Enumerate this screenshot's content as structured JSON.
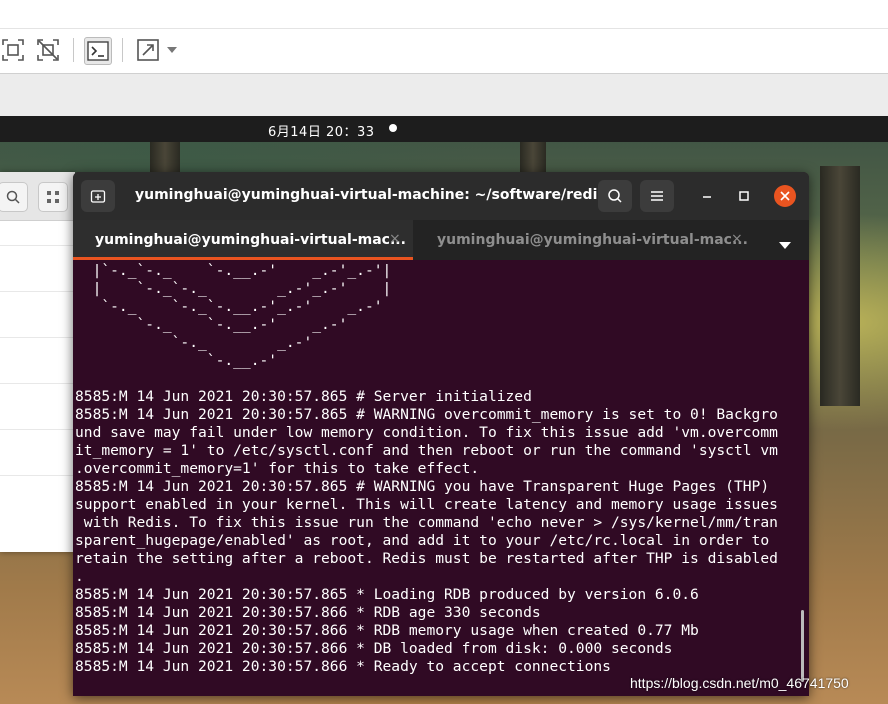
{
  "vm_toolbar": {
    "icons": [
      "fit-window-icon",
      "unscale-icon",
      "console-icon",
      "fullscreen-icon",
      "dropdown-arrow-icon"
    ]
  },
  "topbar": {
    "clock": "6月14日  20：33"
  },
  "terminal": {
    "title": "yuminghuai@yuminghuai-virtual-machine: ~/software/redis/...",
    "tabs": [
      {
        "label": "yuminghuai@yuminghuai-virtual-mac...",
        "active": true,
        "close": "×"
      },
      {
        "label": "yuminghuai@yuminghuai-virtual-mac...",
        "active": false,
        "close": "×"
      }
    ],
    "lines": [
      "  |`-._`-._    `-.__.-'    _.-'_.-'|",
      "  |    `-._`-._        _.-'_.-'    |",
      "   `-._    `-._`-.__.-'_.-'    _.-'",
      "       `-._    `-.__.-'    _.-'",
      "           `-._        _.-'",
      "               `-.__.-'",
      "",
      "8585:M 14 Jun 2021 20:30:57.865 # Server initialized",
      "8585:M 14 Jun 2021 20:30:57.865 # WARNING overcommit_memory is set to 0! Backgro",
      "und save may fail under low memory condition. To fix this issue add 'vm.overcomm",
      "it_memory = 1' to /etc/sysctl.conf and then reboot or run the command 'sysctl vm",
      ".overcommit_memory=1' for this to take effect.",
      "8585:M 14 Jun 2021 20:30:57.865 # WARNING you have Transparent Huge Pages (THP)",
      "support enabled in your kernel. This will create latency and memory usage issues",
      " with Redis. To fix this issue run the command 'echo never > /sys/kernel/mm/tran",
      "sparent_hugepage/enabled' as root, and add it to your /etc/rc.local in order to",
      "retain the setting after a reboot. Redis must be restarted after THP is disabled",
      ".",
      "8585:M 14 Jun 2021 20:30:57.865 * Loading RDB produced by version 6.0.6",
      "8585:M 14 Jun 2021 20:30:57.866 * RDB age 330 seconds",
      "8585:M 14 Jun 2021 20:30:57.866 * RDB memory usage when created 0.77 Mb",
      "8585:M 14 Jun 2021 20:30:57.866 * DB loaded from disk: 0.000 seconds",
      "8585:M 14 Jun 2021 20:30:57.866 * Ready to accept connections"
    ]
  },
  "watermark": "https://blog.csdn.net/m0_46741750",
  "colors": {
    "terminal_bg": "#300a24",
    "accent": "#e95420",
    "header_bg": "#2c2c2c"
  }
}
